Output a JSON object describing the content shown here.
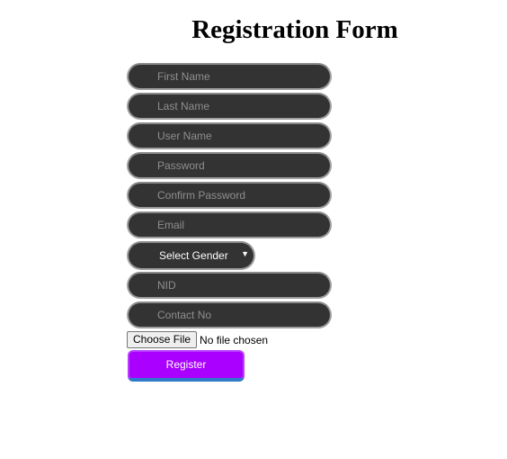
{
  "form": {
    "title": "Registration Form",
    "fields": {
      "first_name": "First Name",
      "last_name": "Last Name",
      "user_name": "User Name",
      "password": "Password",
      "confirm_password": "Confirm Password",
      "email": "Email",
      "nid": "NID",
      "contact_no": "Contact No"
    },
    "gender": {
      "selected": "Select Gender",
      "arrow": "▼"
    },
    "file": {
      "button_label": "Choose File",
      "status": "No file chosen"
    },
    "register_label": "Register"
  },
  "colors": {
    "field_bg": "#333333",
    "register_bg": "#aa00ff",
    "register_underline": "#2f7bc9"
  }
}
